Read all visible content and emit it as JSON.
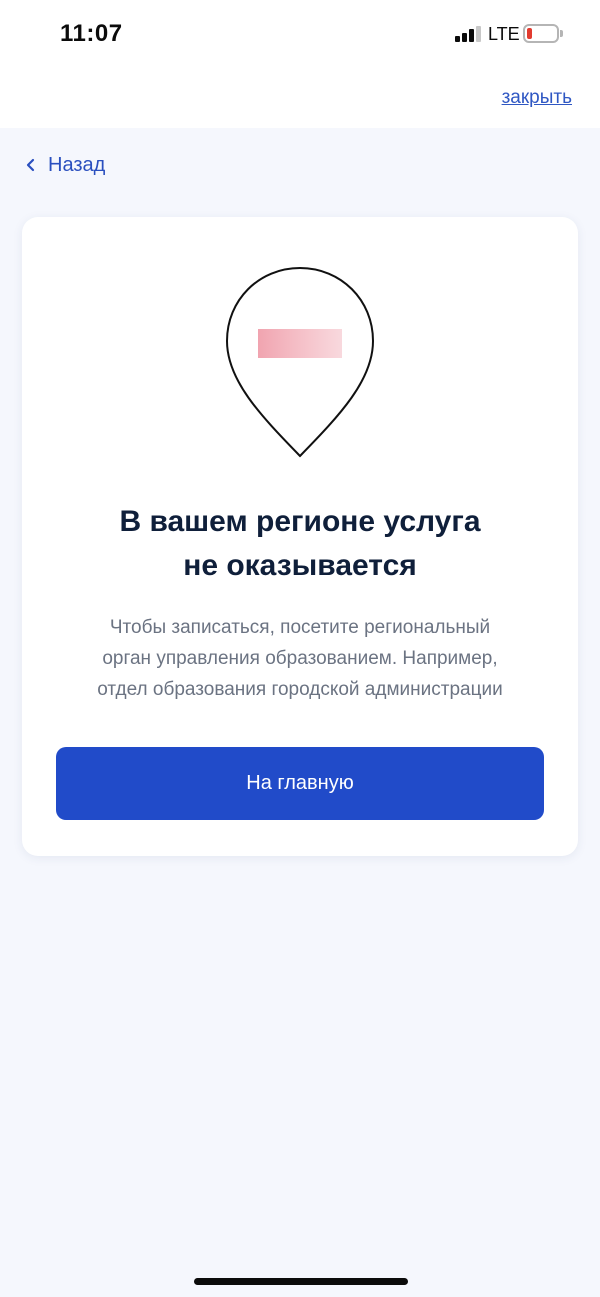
{
  "status_bar": {
    "time": "11:07",
    "network": "LTE",
    "battery_color": "#e23b2f"
  },
  "header": {
    "close_label": "закрыть",
    "back_label": "Назад"
  },
  "card": {
    "title_line1": "В вашем регионе услуга",
    "title_line2": "не оказывается",
    "description_line1": "Чтобы записаться, посетите региональный",
    "description_line2": "орган управления образованием. Например,",
    "description_line3": "отдел образования городской администрации",
    "button_label": "На главную",
    "icon": "map-pin-icon"
  },
  "colors": {
    "accent": "#214bc9",
    "link": "#2f57c3",
    "background": "#f5f7fd",
    "title": "#0f1f3a",
    "text_muted": "#6b7382"
  }
}
